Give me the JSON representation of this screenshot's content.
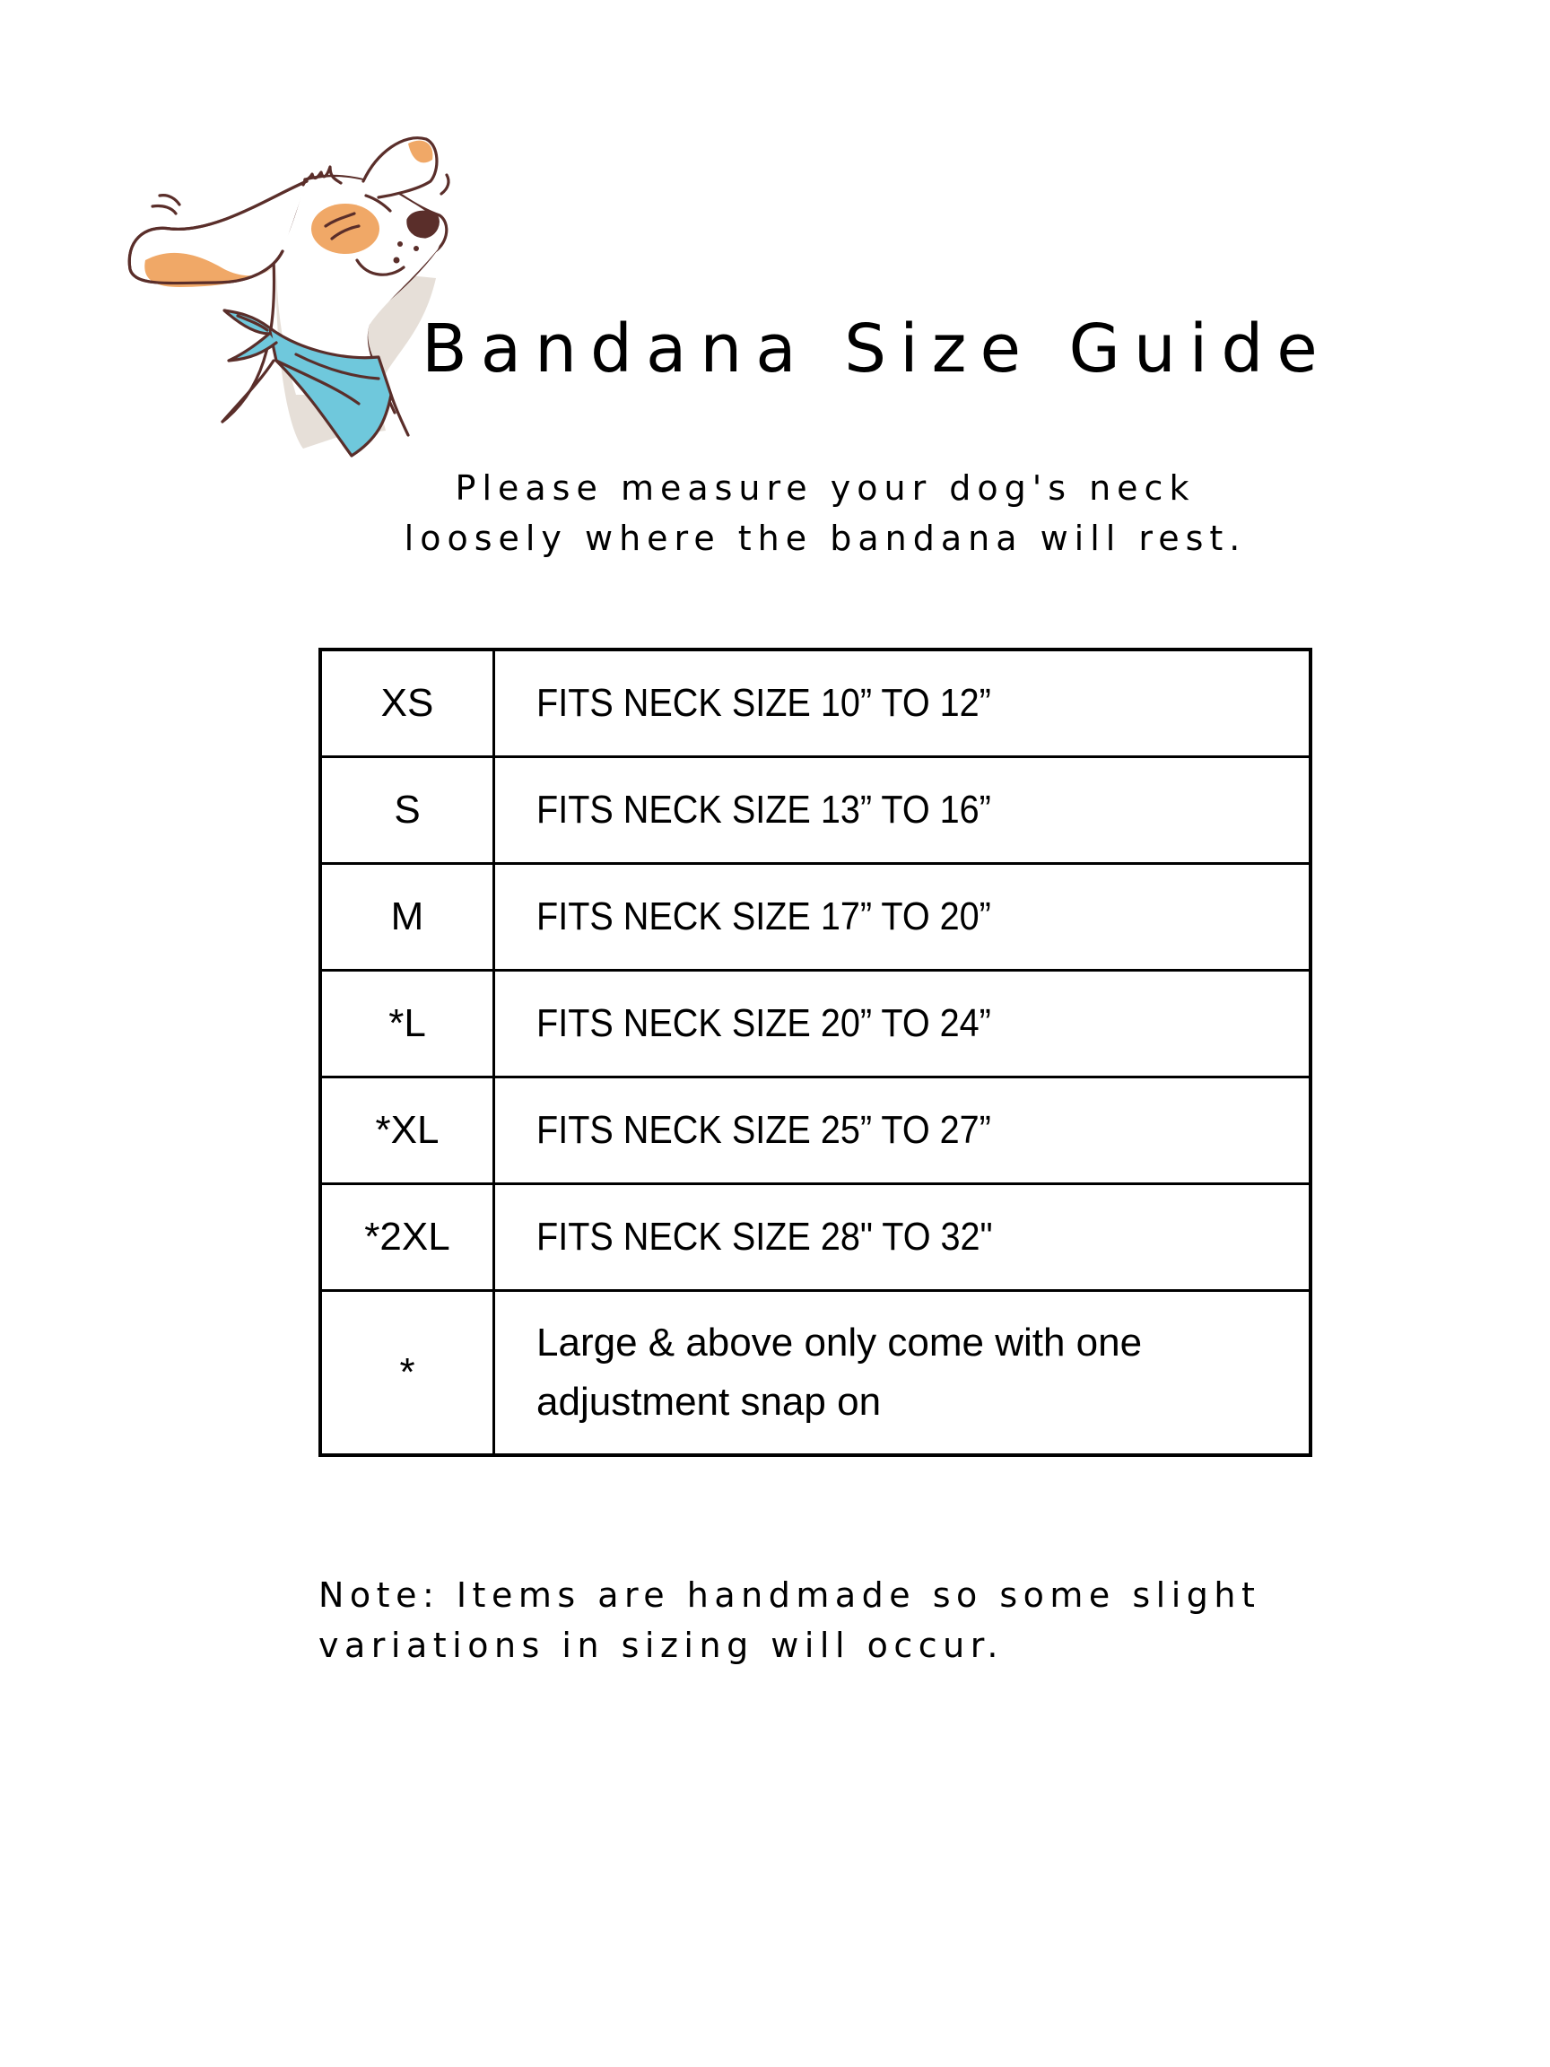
{
  "header": {
    "title": "Bandana Size Guide",
    "subtitle_line1": "Please measure your dog's neck",
    "subtitle_line2": "loosely where the bandana will rest."
  },
  "illustration": {
    "icon": "dog-with-bandana-icon",
    "colors": {
      "outline": "#5a2e2a",
      "patch": "#f0a867",
      "bandana": "#6fc8dc",
      "shadow": "#e6dfd8"
    }
  },
  "size_table": {
    "rows": [
      {
        "size": "XS",
        "description": "FITS NECK SIZE 10” TO 12”"
      },
      {
        "size": "S",
        "description": "FITS NECK SIZE 13” TO 16”"
      },
      {
        "size": "M",
        "description": "FITS NECK SIZE 17” TO 20”"
      },
      {
        "size": "*L",
        "description": "FITS NECK SIZE 20” TO 24”"
      },
      {
        "size": "*XL",
        "description": "FITS NECK SIZE 25” TO 27”"
      },
      {
        "size": "*2XL",
        "description": "FITS NECK SIZE 28\" TO 32\""
      }
    ],
    "note_row": {
      "symbol": "*",
      "text": "Large & above only come with one adjustment snap on"
    }
  },
  "footnote": {
    "line1": "Note: Items are handmade so some slight",
    "line2": "variations in sizing will occur."
  }
}
